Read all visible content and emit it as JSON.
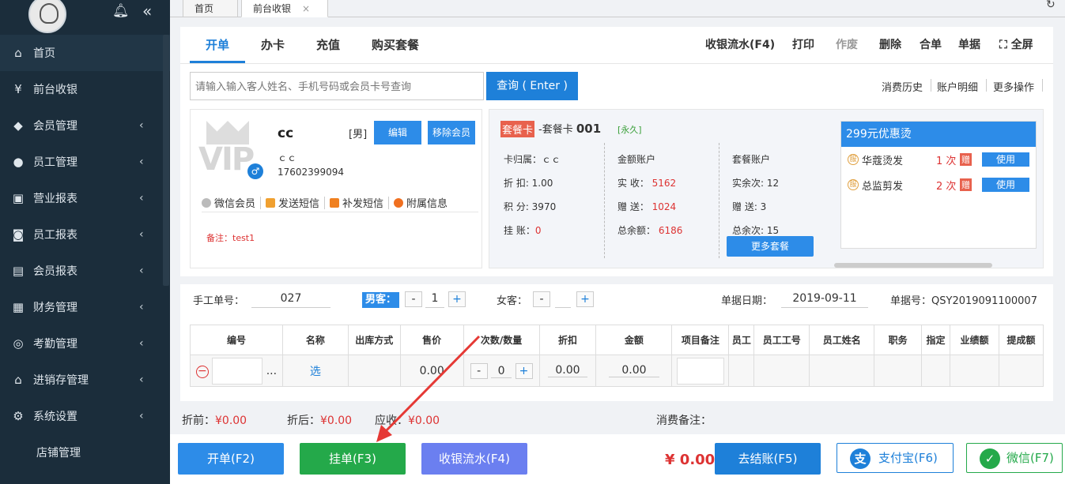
{
  "sidebar": {
    "items": [
      {
        "label": "首页",
        "icon": "home-icon"
      },
      {
        "label": "前台收银",
        "icon": "cashier-icon"
      },
      {
        "label": "会员管理",
        "icon": "member-icon"
      },
      {
        "label": "员工管理",
        "icon": "staff-icon"
      },
      {
        "label": "营业报表",
        "icon": "report-icon"
      },
      {
        "label": "员工报表",
        "icon": "staff-report-icon"
      },
      {
        "label": "会员报表",
        "icon": "member-report-icon"
      },
      {
        "label": "财务管理",
        "icon": "finance-icon"
      },
      {
        "label": "考勤管理",
        "icon": "fingerprint-icon"
      },
      {
        "label": "进销存管理",
        "icon": "inventory-icon"
      },
      {
        "label": "系统设置",
        "icon": "gear-icon"
      },
      {
        "label": "店铺管理",
        "icon": ""
      }
    ]
  },
  "tabs": {
    "home": "首页",
    "cashier": "前台收银"
  },
  "toptabs": [
    "开单",
    "办卡",
    "充值",
    "购买套餐"
  ],
  "actions": [
    "收银流水(F4)",
    "打印",
    "作废",
    "删除",
    "合单",
    "单据",
    "全屏"
  ],
  "search": {
    "placeholder": "请输入输入客人姓名、手机号码或会员卡号查询",
    "button": "查询 ( Enter )"
  },
  "right_links": [
    "消费历史",
    "账户明细",
    "更多操作"
  ],
  "member": {
    "name": "cc",
    "gender": "[男]",
    "edit": "编辑",
    "remove": "移除会员",
    "sub_name": "ｃｃ",
    "phone": "17602399094",
    "links": [
      "微信会员",
      "发送短信",
      "补发短信",
      "附属信息"
    ],
    "note": "备注：test1"
  },
  "card": {
    "type": "套餐卡",
    "name_prefix": "-套餐卡 ",
    "number": "001",
    "permanent": "[永久]",
    "col1": {
      "owner": "卡归属：ｃｃ",
      "discount": "折 扣: 1.00",
      "points": "积 分: 3970",
      "hang_label": "挂 账：",
      "hang_value": "0"
    },
    "col2": {
      "title": "金额账户",
      "recv_label": "实 收：",
      "recv_value": "5162",
      "gift_label": "赠 送：",
      "gift_value": "1024",
      "total_label": "总余额：",
      "total_value": "6186"
    },
    "col3": {
      "title": "套餐账户",
      "real": "实余次: 12",
      "gift": "赠 送: 3",
      "total": "总余次: 15"
    },
    "more": "更多套餐"
  },
  "package": {
    "title": "299元优惠烫",
    "rows": [
      {
        "name": "华蔻烫发",
        "count": "1 次",
        "gift": "赠",
        "use": "使用"
      },
      {
        "name": "总监剪发",
        "count": "2 次",
        "gift": "赠",
        "use": "使用"
      }
    ]
  },
  "order": {
    "manual_label": "手工单号：",
    "manual_value": "027",
    "male_label": "男客：",
    "male_count": "1",
    "female_label": "女客：",
    "female_count": "",
    "date_label": "单据日期：",
    "date_value": "2019-09-11",
    "bill_label": "单据号：",
    "bill_value": "QSY2019091100007"
  },
  "table": {
    "headers": [
      "编号",
      "名称",
      "出库方式",
      "售价",
      "次数/数量",
      "折扣",
      "金额",
      "项目备注",
      "员工",
      "员工工号",
      "员工姓名",
      "职务",
      "指定",
      "业绩额",
      "提成额"
    ],
    "row": {
      "dots": "...",
      "choose": "选",
      "price": "0.00",
      "qty": "0",
      "discount": "0.00",
      "amount": "0.00"
    }
  },
  "summary": {
    "before_label": "折前：",
    "before": "¥0.00",
    "after_label": "折后：",
    "after": "¥0.00",
    "due_label": "应收：",
    "due": "¥0.00",
    "remark_label": "消费备注："
  },
  "bottom": {
    "open": "开单(F2)",
    "hang": "挂单(F3)",
    "flow": "收银流水(F4)",
    "total": "¥ 0.00",
    "checkout": "去结账(F5)",
    "alipay": "支付宝(F6)",
    "wechat": "微信(F7)"
  },
  "colors": {
    "primary": "#1e80d9",
    "sidebar": "#1b2d3b",
    "green": "#24a94a",
    "purple": "#6b7ff0",
    "red": "#d33333"
  }
}
